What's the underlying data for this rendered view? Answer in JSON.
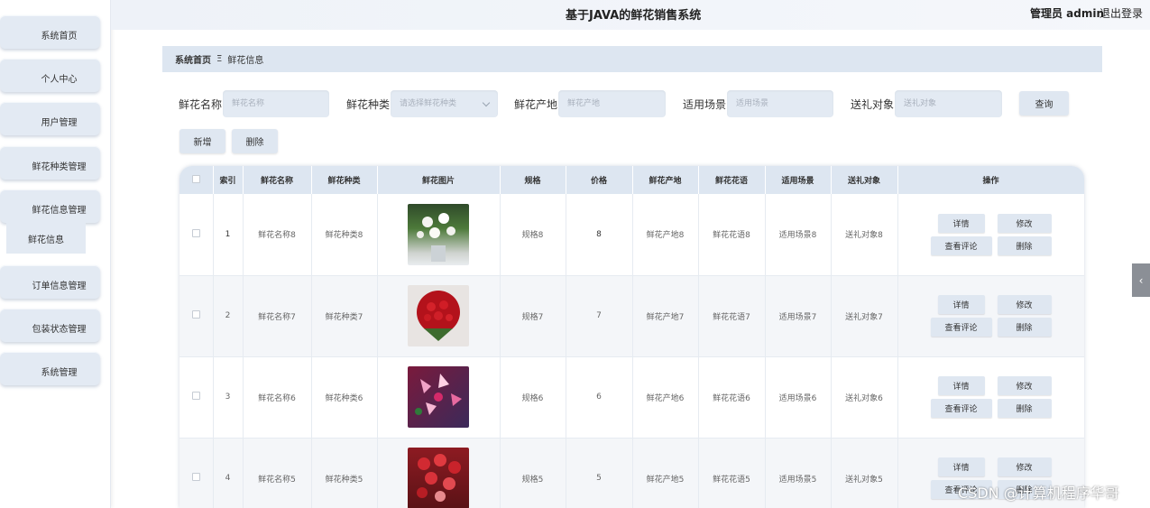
{
  "sidebar": {
    "items": [
      {
        "label": "系统首页"
      },
      {
        "label": "个人中心"
      },
      {
        "label": "用户管理"
      },
      {
        "label": "鲜花种类管理"
      },
      {
        "label": "鲜花信息管理"
      },
      {
        "label": "订单信息管理"
      },
      {
        "label": "包装状态管理"
      },
      {
        "label": "系统管理"
      }
    ],
    "sub_item": "鲜花信息"
  },
  "header": {
    "title": "基于JAVA的鲜花销售系统",
    "admin": "管理员 admin",
    "logout": "退出登录"
  },
  "breadcrumb": {
    "home": "系统首页",
    "separator": "Ξ",
    "current": "鲜花信息"
  },
  "search": {
    "name_label": "鲜花名称",
    "name_placeholder": "鲜花名称",
    "type_label": "鲜花种类",
    "type_placeholder": "请选择鲜花种类",
    "origin_label": "鲜花产地",
    "origin_placeholder": "鲜花产地",
    "scene_label": "适用场景",
    "scene_placeholder": "适用场景",
    "gift_label": "送礼对象",
    "gift_placeholder": "送礼对象",
    "query_button": "查询"
  },
  "actions": {
    "add": "新增",
    "delete": "删除"
  },
  "table": {
    "columns": [
      "索引",
      "鲜花名称",
      "鲜花种类",
      "鲜花图片",
      "规格",
      "价格",
      "鲜花产地",
      "鲜花花语",
      "适用场景",
      "送礼对象",
      "操作"
    ],
    "rows": [
      {
        "index": "1",
        "name": "鲜花名称8",
        "type": "鲜花种类8",
        "spec": "规格8",
        "price": "8",
        "origin": "鲜花产地8",
        "language": "鲜花花语8",
        "scene": "适用场景8",
        "gift": "送礼对象8"
      },
      {
        "index": "2",
        "name": "鲜花名称7",
        "type": "鲜花种类7",
        "spec": "规格7",
        "price": "7",
        "origin": "鲜花产地7",
        "language": "鲜花花语7",
        "scene": "适用场景7",
        "gift": "送礼对象7"
      },
      {
        "index": "3",
        "name": "鲜花名称6",
        "type": "鲜花种类6",
        "spec": "规格6",
        "price": "6",
        "origin": "鲜花产地6",
        "language": "鲜花花语6",
        "scene": "适用场景6",
        "gift": "送礼对象6"
      },
      {
        "index": "4",
        "name": "鲜花名称5",
        "type": "鲜花种类5",
        "spec": "规格5",
        "price": "5",
        "origin": "鲜花产地5",
        "language": "鲜花花语5",
        "scene": "适用场景5",
        "gift": "送礼对象5"
      }
    ],
    "row_ops": {
      "detail": "详情",
      "edit": "修改",
      "reviews": "查看评论",
      "delete": "删除"
    }
  },
  "watermark": "CSDN @计算机程序华哥"
}
